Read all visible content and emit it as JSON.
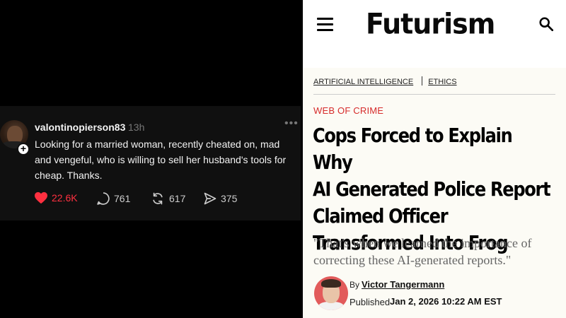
{
  "post": {
    "username": "valontinopierson83",
    "time": "13h",
    "more": "•••",
    "follow_glyph": "+",
    "text": "Looking for a married woman, recently cheated on, mad and vengeful, who is willing to sell her husband's tools for cheap. Thanks.",
    "actions": {
      "likes": "22.6K",
      "replies": "761",
      "reposts": "617",
      "shares": "375"
    },
    "colors": {
      "like": "#ff3040",
      "background": "#101010"
    }
  },
  "article": {
    "site_name": "Futurism",
    "categories": [
      "ARTIFICIAL INTELLIGENCE",
      "ETHICS"
    ],
    "kicker": "WEB OF CRIME",
    "headline_lines": [
      "Cops Forced to Explain Why",
      "AI Generated Police Report",
      "Claimed Officer",
      "Transformed Into Frog"
    ],
    "dek": "\"That's when we learned the importance of correcting these AI-generated reports.\"",
    "by_label": "By",
    "author": "Victor Tangermann",
    "published_label": "Published",
    "published_date": "Jan 2, 2026 10:22 AM EST",
    "colors": {
      "kicker": "#d62b2b",
      "background": "#fcfbf5"
    },
    "icons": {
      "menu": "hamburger-menu-icon",
      "search": "search-icon"
    }
  }
}
